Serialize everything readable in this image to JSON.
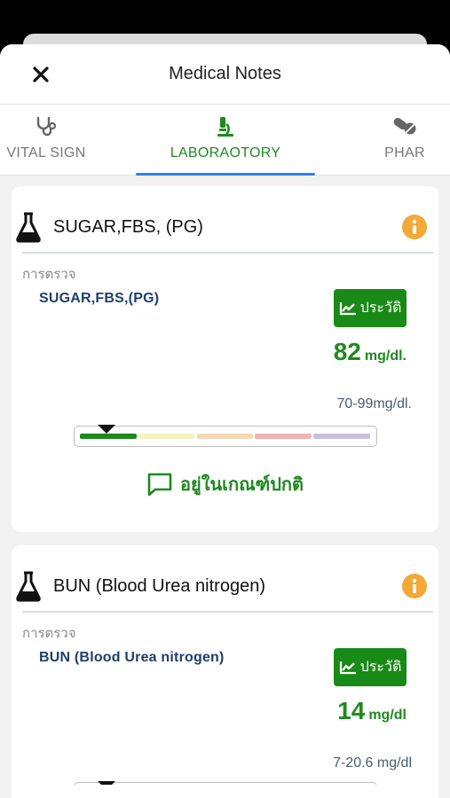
{
  "header": {
    "title": "Medical Notes"
  },
  "tabs": [
    {
      "label": "VITAL SIGN",
      "icon": "stethoscope-icon",
      "active": false
    },
    {
      "label": "LABORAOTORY",
      "icon": "microscope-icon",
      "active": true
    },
    {
      "label": "PHAR",
      "icon": "pills-icon",
      "active": false
    }
  ],
  "colors": {
    "accent": "#1e8a1e",
    "tab_indicator": "#2f80e6",
    "info": "#f3a838",
    "button": "#198a17"
  },
  "labs": [
    {
      "title": "SUGAR,FBS, (PG)",
      "exam_label": "การตรวจ",
      "test_name": "SUGAR,FBS,(PG)",
      "history_label": "ประวัติ",
      "value": "82",
      "unit": "mg/dl.",
      "range": "70-99mg/dl.",
      "level_band": 1,
      "status": "อยู่ในเกณฑ์ปกติ"
    },
    {
      "title": "BUN (Blood Urea nitrogen)",
      "exam_label": "การตรวจ",
      "test_name": "BUN (Blood Urea nitrogen)",
      "history_label": "ประวัติ",
      "value": "14",
      "unit": "mg/dl",
      "range": "7-20.6 mg/dl",
      "level_band": 1
    }
  ]
}
